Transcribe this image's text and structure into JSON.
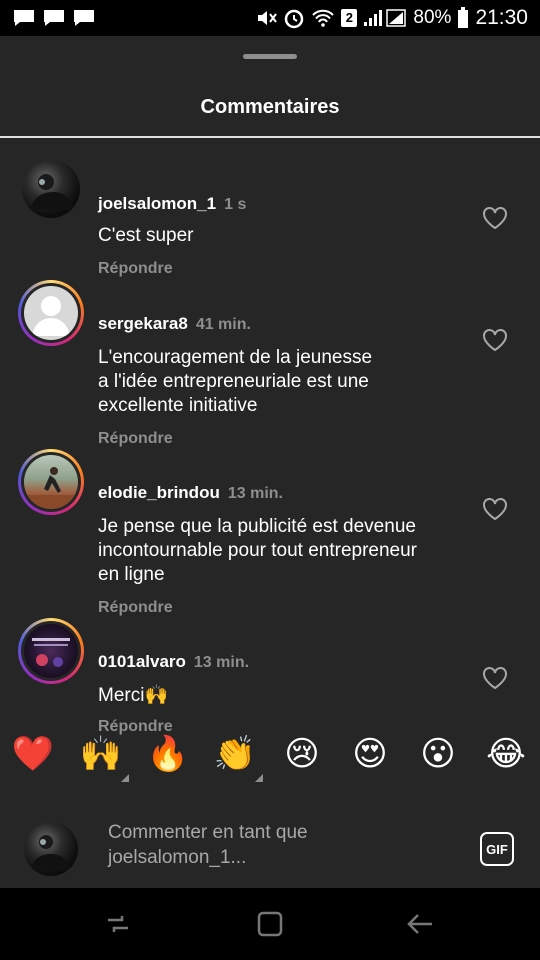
{
  "status_bar": {
    "battery": "80%",
    "time": "21:30",
    "sim_badge": "2"
  },
  "sheet": {
    "title": "Commentaires"
  },
  "comments": [
    {
      "username": "joelsalomon_1",
      "time_ago": "1 s",
      "lines": [
        "C'est super"
      ],
      "reply_label": "Répondre",
      "has_story_ring": false
    },
    {
      "username": "sergekara8",
      "time_ago": "41 min.",
      "lines": [
        "L'encouragement de la jeunesse",
        "a l'idée entrepreneuriale est une",
        "excellente initiative"
      ],
      "reply_label": "Répondre",
      "has_story_ring": true
    },
    {
      "username": "elodie_brindou",
      "time_ago": "13 min.",
      "lines": [
        "Je pense que la publicité est devenue",
        "incontournable pour tout entrepreneur",
        "en ligne"
      ],
      "reply_label": "Répondre",
      "has_story_ring": true
    },
    {
      "username": "0101alvaro",
      "time_ago": "13 min.",
      "lines": [
        "Merci🙌"
      ],
      "reply_label": "Répondre",
      "has_story_ring": true
    }
  ],
  "emoji_reactions": [
    "❤️",
    "🙌",
    "🔥",
    "👏",
    "😢",
    "😍",
    "😮",
    "😂"
  ],
  "compose": {
    "placeholder_line1": "Commenter en tant que",
    "placeholder_line2": "joelsalomon_1...",
    "gif_label": "GIF"
  },
  "colors": {
    "sheet_bg": "#262626",
    "secondary_text": "#8e8e8e",
    "divider": "#e0e0e0"
  }
}
